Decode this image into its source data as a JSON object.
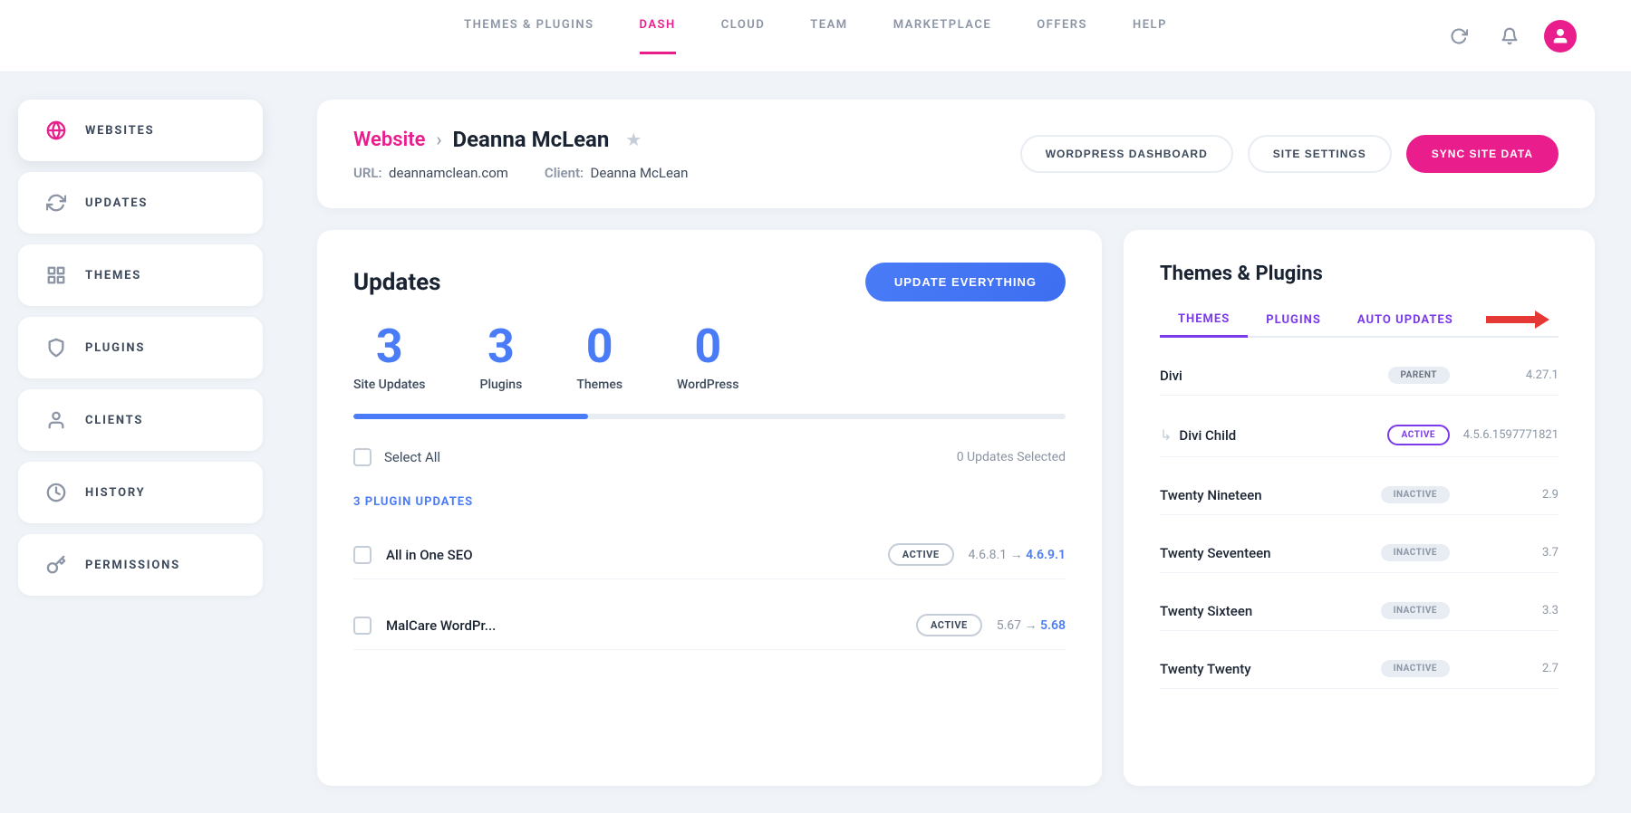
{
  "topnav": {
    "links": [
      {
        "label": "THEMES & PLUGINS",
        "active": false
      },
      {
        "label": "DASH",
        "active": true
      },
      {
        "label": "CLOUD",
        "active": false
      },
      {
        "label": "TEAM",
        "active": false
      },
      {
        "label": "MARKETPLACE",
        "active": false
      },
      {
        "label": "OFFERS",
        "active": false
      },
      {
        "label": "HELP",
        "active": false
      }
    ]
  },
  "sidebar": {
    "items": [
      {
        "label": "WEBSITES",
        "icon": "globe",
        "active": true
      },
      {
        "label": "UPDATES",
        "icon": "refresh",
        "active": false
      },
      {
        "label": "THEMES",
        "icon": "layout",
        "active": false
      },
      {
        "label": "PLUGINS",
        "icon": "shield",
        "active": false
      },
      {
        "label": "CLIENTS",
        "icon": "user",
        "active": false
      },
      {
        "label": "HISTORY",
        "icon": "clock",
        "active": false
      },
      {
        "label": "PERMISSIONS",
        "icon": "key",
        "active": false
      }
    ]
  },
  "header": {
    "breadcrumb_website": "Website",
    "breadcrumb_separator": "›",
    "site_name": "Deanna McLean",
    "url_label": "URL:",
    "url_value": "deannamclean.com",
    "client_label": "Client:",
    "client_value": "Deanna McLean",
    "btn_wordpress": "WORDPRESS DASHBOARD",
    "btn_settings": "SITE SETTINGS",
    "btn_sync": "SYNC SITE DATA"
  },
  "updates": {
    "title": "Updates",
    "btn_update": "UPDATE EVERYTHING",
    "stats": [
      {
        "number": "3",
        "label": "Site Updates"
      },
      {
        "number": "3",
        "label": "Plugins"
      },
      {
        "number": "0",
        "label": "Themes"
      },
      {
        "number": "0",
        "label": "WordPress"
      }
    ],
    "progress_percent": 33,
    "select_all_label": "Select All",
    "updates_selected": "0 Updates Selected",
    "plugin_section_label": "3 PLUGIN UPDATES",
    "plugins": [
      {
        "name": "All in One SEO",
        "badge": "ACTIVE",
        "version_from": "4.6.8.1",
        "version_to": "4.6.9.1"
      },
      {
        "name": "MalCare WordPr...",
        "badge": "ACTIVE",
        "version_from": "5.67",
        "version_to": "5.68"
      }
    ]
  },
  "themes_panel": {
    "title": "Themes & Plugins",
    "tabs": [
      {
        "label": "THEMES",
        "active": true
      },
      {
        "label": "PLUGINS",
        "active": false
      },
      {
        "label": "AUTO UPDATES",
        "active": false
      }
    ],
    "themes": [
      {
        "name": "Divi",
        "badge_type": "parent",
        "badge_label": "PARENT",
        "version": "4.27.1",
        "is_sub": false
      },
      {
        "name": "Divi Child",
        "badge_type": "active",
        "badge_label": "ACTIVE",
        "version": "4.5.6.1597771821",
        "is_sub": true
      },
      {
        "name": "Twenty Nineteen",
        "badge_type": "inactive",
        "badge_label": "INACTIVE",
        "version": "2.9",
        "is_sub": false
      },
      {
        "name": "Twenty Seventeen",
        "badge_type": "inactive",
        "badge_label": "INACTIVE",
        "version": "3.7",
        "is_sub": false
      },
      {
        "name": "Twenty Sixteen",
        "badge_type": "inactive",
        "badge_label": "INACTIVE",
        "version": "3.3",
        "is_sub": false
      },
      {
        "name": "Twenty Twenty",
        "badge_type": "inactive",
        "badge_label": "INACTIVE",
        "version": "2.7",
        "is_sub": false
      }
    ]
  },
  "colors": {
    "pink": "#e91e8c",
    "blue": "#4a7cf7",
    "purple": "#7c3aed",
    "red": "#e53935"
  }
}
